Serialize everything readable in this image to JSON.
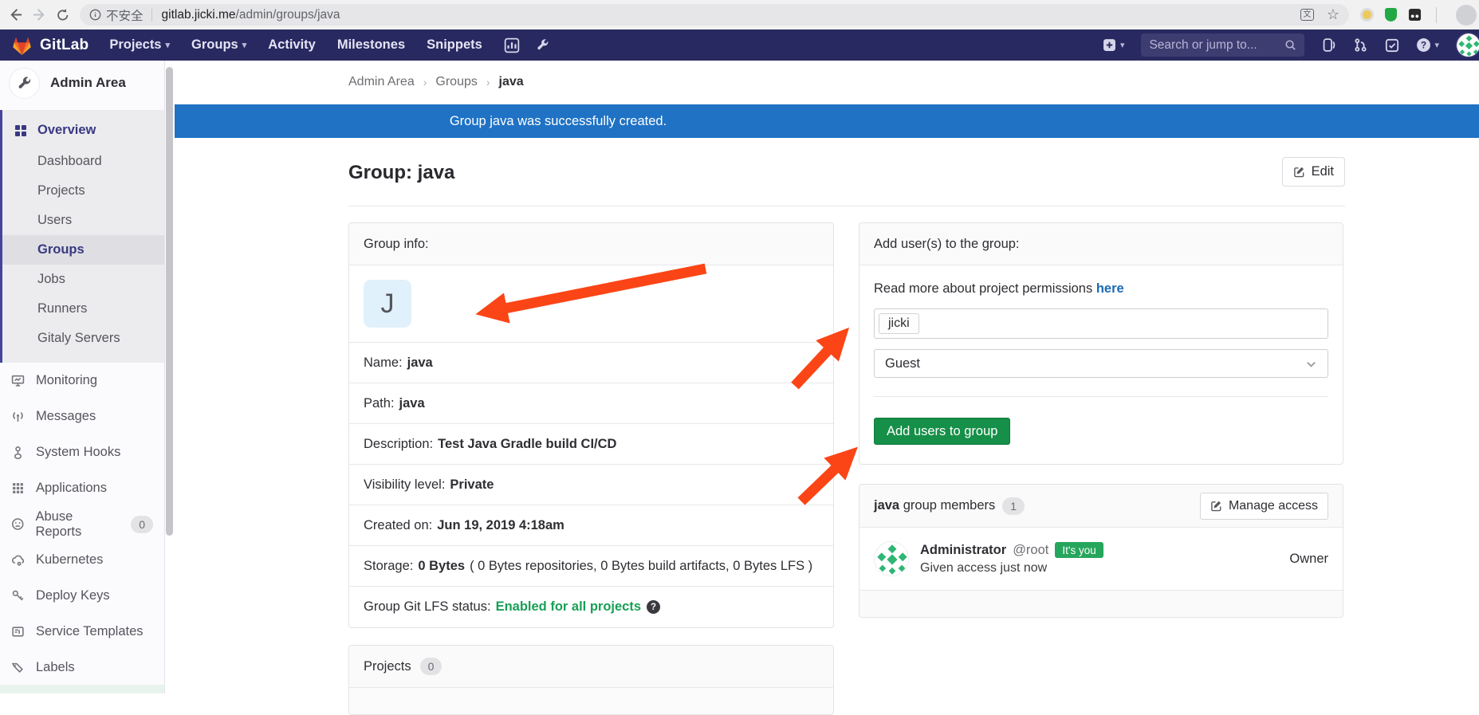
{
  "browser": {
    "security_label": "不安全",
    "host": "gitlab.jicki.me",
    "path": "/admin/groups/java"
  },
  "navbar": {
    "brand": "GitLab",
    "links": [
      "Projects",
      "Groups",
      "Activity",
      "Milestones",
      "Snippets"
    ],
    "search_placeholder": "Search or jump to..."
  },
  "sidebar": {
    "title": "Admin Area",
    "overview": {
      "label": "Overview",
      "items": [
        "Dashboard",
        "Projects",
        "Users",
        "Groups",
        "Jobs",
        "Runners",
        "Gitaly Servers"
      ],
      "active_item": "Groups"
    },
    "items": [
      {
        "label": "Monitoring"
      },
      {
        "label": "Messages"
      },
      {
        "label": "System Hooks"
      },
      {
        "label": "Applications"
      },
      {
        "label": "Abuse Reports",
        "badge": "0"
      },
      {
        "label": "Kubernetes"
      },
      {
        "label": "Deploy Keys"
      },
      {
        "label": "Service Templates"
      },
      {
        "label": "Labels"
      }
    ]
  },
  "breadcrumb": {
    "items": [
      "Admin Area",
      "Groups"
    ],
    "current": "java"
  },
  "flash": {
    "message": "Group java was successfully created."
  },
  "page": {
    "title": "Group: java",
    "edit_label": "Edit"
  },
  "group_info": {
    "header": "Group info:",
    "avatar_letter": "J",
    "rows": [
      {
        "label": "Name:",
        "value": "java"
      },
      {
        "label": "Path:",
        "value": "java"
      },
      {
        "label": "Description:",
        "value": "Test Java Gradle build CI/CD"
      },
      {
        "label": "Visibility level:",
        "value": "Private"
      },
      {
        "label": "Created on:",
        "value": "Jun 19, 2019 4:18am"
      },
      {
        "label": "Storage:",
        "value": "0 Bytes",
        "suffix": "( 0 Bytes repositories, 0 Bytes build artifacts, 0 Bytes LFS )"
      },
      {
        "label": "Group Git LFS status:",
        "value": "Enabled for all projects"
      }
    ]
  },
  "projects_panel": {
    "header": "Projects",
    "badge": "0"
  },
  "add_users": {
    "header": "Add user(s) to the group:",
    "permissions_text": "Read more about project permissions",
    "permissions_link": "here",
    "user_token": "jicki",
    "role_value": "Guest",
    "submit_label": "Add users to group"
  },
  "members": {
    "group": "java",
    "header_suffix": "group members",
    "count": "1",
    "manage_label": "Manage access",
    "member": {
      "name": "Administrator",
      "username": "@root",
      "you_badge": "It's you",
      "meta": "Given access just now",
      "role": "Owner"
    }
  },
  "colors": {
    "navbar_bg": "#292961",
    "flash_bg": "#1f72c4",
    "button_green": "#168f48",
    "link_blue": "#1b69b6",
    "lfs_green": "#18a055",
    "arrow_red": "#fb4516",
    "active_indigo": "#393982"
  }
}
